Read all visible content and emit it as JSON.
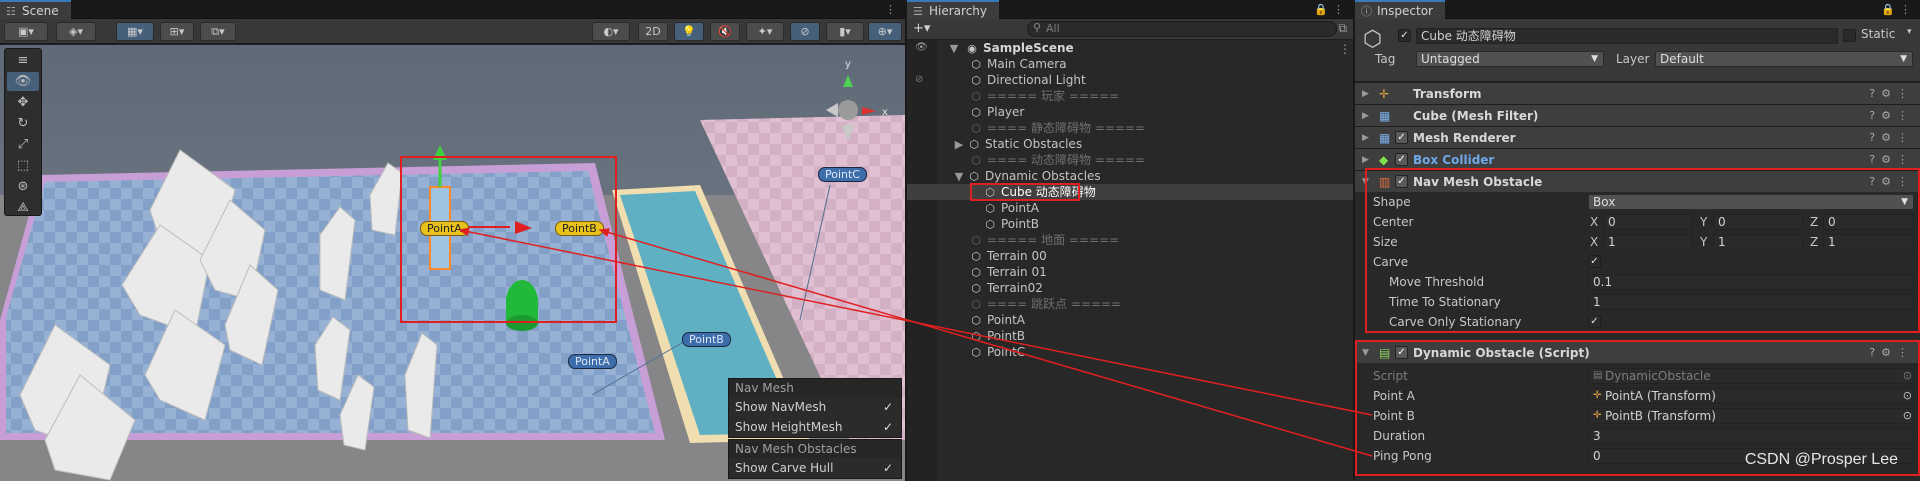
{
  "scene": {
    "tab": "Scene",
    "toolbar": {
      "mode2d": "2D"
    },
    "labels": {
      "pointa_sel": "PointA",
      "pointb_sel": "PointB",
      "pointc": "PointC",
      "pointb": "PointB",
      "pointa": "PointA"
    },
    "overlay_navmesh": {
      "header": "Nav Mesh",
      "show_navmesh": "Show NavMesh",
      "show_heightmesh": "Show HeightMesh",
      "check": "✓"
    },
    "overlay_obstacles": {
      "header": "Nav Mesh Obstacles",
      "show_carve_hull": "Show Carve Hull",
      "check": "✓"
    }
  },
  "hierarchy": {
    "tab": "Hierarchy",
    "add": "+▾",
    "search_placeholder": "All",
    "items": [
      {
        "label": "SampleScene"
      },
      {
        "label": "Main Camera"
      },
      {
        "label": "Directional Light"
      },
      {
        "label": "===== 玩家 ====="
      },
      {
        "label": "Player"
      },
      {
        "label": "==== 静态障碍物 ====="
      },
      {
        "label": "Static Obstacles"
      },
      {
        "label": "==== 动态障碍物 ====="
      },
      {
        "label": "Dynamic Obstacles"
      },
      {
        "label": "Cube 动态障碍物"
      },
      {
        "label": "PointA"
      },
      {
        "label": "PointB"
      },
      {
        "label": "===== 地面 ====="
      },
      {
        "label": "Terrain 00"
      },
      {
        "label": "Terrain 01"
      },
      {
        "label": "Terrain02"
      },
      {
        "label": "==== 跳跃点 ====="
      },
      {
        "label": "PointA"
      },
      {
        "label": "PointB"
      },
      {
        "label": "PointC"
      }
    ]
  },
  "inspector": {
    "tab": "Inspector",
    "object_name": "Cube 动态障碍物",
    "static_label": "Static",
    "tag_label": "Tag",
    "tag_value": "Untagged",
    "layer_label": "Layer",
    "layer_value": "Default",
    "components": {
      "transform": "Transform",
      "mesh_filter": "Cube (Mesh Filter)",
      "mesh_renderer": "Mesh Renderer",
      "box_collider": "Box Collider",
      "nav_mesh_obstacle": "Nav Mesh Obstacle",
      "dynamic_obstacle": "Dynamic Obstacle (Script)"
    },
    "nav": {
      "shape_label": "Shape",
      "shape_value": "Box",
      "center_label": "Center",
      "center": {
        "x": "0",
        "y": "0",
        "z": "0"
      },
      "size_label": "Size",
      "size": {
        "x": "1",
        "y": "1",
        "z": "1"
      },
      "carve_label": "Carve",
      "move_threshold_label": "Move Threshold",
      "move_threshold": "0.1",
      "time_to_stationary_label": "Time To Stationary",
      "time_to_stationary": "1",
      "carve_only_stationary_label": "Carve Only Stationary"
    },
    "script": {
      "script_label": "Script",
      "script_value": "DynamicObstacle",
      "point_a_label": "Point A",
      "point_a_value": "PointA (Transform)",
      "point_b_label": "Point B",
      "point_b_value": "PointB (Transform)",
      "duration_label": "Duration",
      "duration_value": "3",
      "ping_pong_label": "Ping Pong",
      "ping_pong_value": "0"
    },
    "axis": {
      "x": "X",
      "y": "Y",
      "z": "Z"
    }
  },
  "watermark": "CSDN @Prosper Lee",
  "colors": {
    "accent_blue": "#3a79bb",
    "highlight_red": "#e02020",
    "selection_text": "#ffffff"
  }
}
